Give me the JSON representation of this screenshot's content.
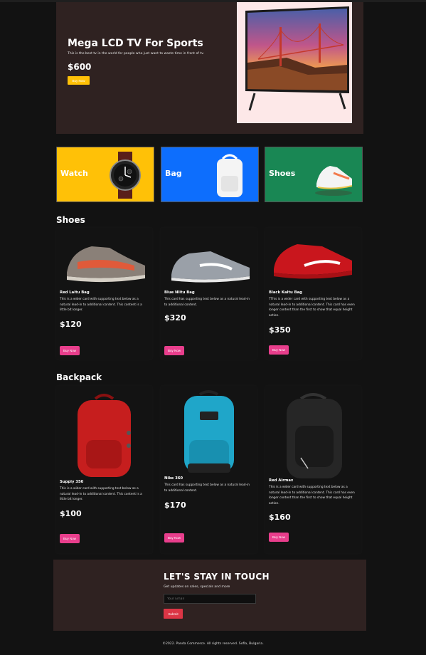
{
  "hero": {
    "title": "Mega LCD TV For Sports",
    "description": "This is the best tv in the world for people who just want to waste time in front of tv.",
    "price": "$600",
    "button_label": "Buy Now",
    "image_icon": "tv-icon"
  },
  "categories": [
    {
      "label": "Watch",
      "icon": "watch-icon",
      "color": "#ffc107"
    },
    {
      "label": "Bag",
      "icon": "backpack-icon",
      "color": "#0d6efd"
    },
    {
      "label": "Shoes",
      "icon": "sneaker-icon",
      "color": "#198754"
    }
  ],
  "shoes": {
    "title": "Shoes",
    "items": [
      {
        "name": "Red Laitu Bag",
        "text": "This is a wider card with supporting text below as a natural lead-in to additional content. This content is a little bit longer.",
        "price": "$120",
        "button_label": "Buy Now"
      },
      {
        "name": "Blue Nlitu Bag",
        "text": "This card has supporting text below as a natural lead-in to additional content.",
        "price": "$320",
        "button_label": "Buy Now"
      },
      {
        "name": "Black Kaltu Bag",
        "text": "TThis is a wider card with supporting text below as a natural lead-in to additional content. This card has even longer content than the first to show that equal height action.",
        "price": "$350",
        "button_label": "Buy Now"
      }
    ]
  },
  "backpack": {
    "title": "Backpack",
    "items": [
      {
        "name": "Supply 350",
        "text": "This is a wider card with supporting text below as a natural lead-in to additional content. This content is a little bit longer.",
        "price": "$100",
        "button_label": "Buy Now"
      },
      {
        "name": "Nike 360",
        "text": "This card has supporting text below as a natural lead-in to additional content.",
        "price": "$170",
        "button_label": "Buy Now"
      },
      {
        "name": "Red Airmax",
        "text": "This is a wider card with supporting text below as a natural lead-in to additional content. This card has even longer content than the first to show that equal height action.",
        "price": "$160",
        "button_label": "Buy Now"
      }
    ]
  },
  "newsletter": {
    "title": "LET'S STAY IN TOUCH",
    "subtitle": "Get updates on sales, specials and more",
    "email_placeholder": "Your Email",
    "submit_label": "Submit"
  },
  "footer": {
    "copyright": "©2022. Panda Commerce. All rights reserved. Sofia, Bulgaria."
  },
  "colors": {
    "page_bg": "#121212",
    "hero_bg": "#2f2221",
    "yellow": "#ffc107",
    "blue": "#0d6efd",
    "green": "#198754",
    "pink": "#e83e8c",
    "red": "#dc3545"
  }
}
